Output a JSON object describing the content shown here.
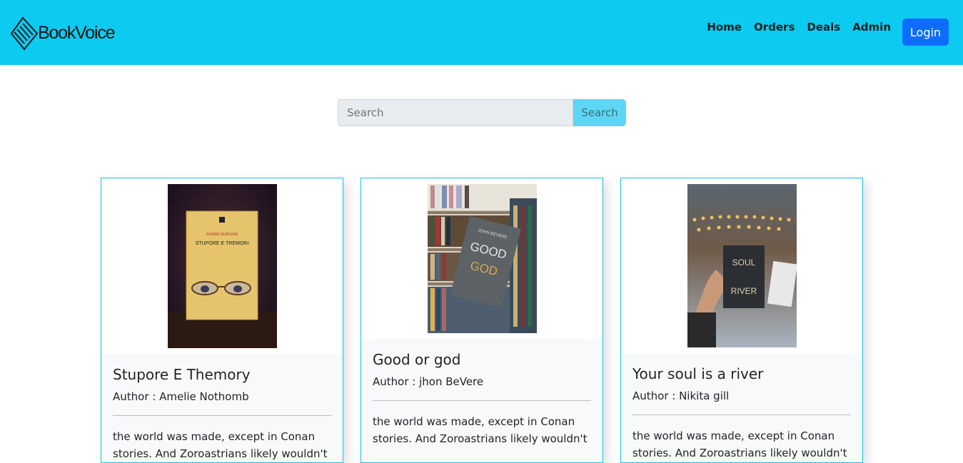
{
  "header": {
    "brand": "BookVoice",
    "nav": [
      "Home",
      "Orders",
      "Deals",
      "Admin"
    ],
    "login_label": "Login"
  },
  "search": {
    "placeholder": "Search",
    "button_label": "Search"
  },
  "books": [
    {
      "title": "Stupore E Themory",
      "author": "Author : Amelie Nothomb",
      "description": "the world was made, except in Conan stories. And Zoroastrians likely wouldn't",
      "cover_label_author": "Amélie Nothomb",
      "cover_label_title": "STUPORE E TREMORI"
    },
    {
      "title": "Good or god",
      "author": "Author : jhon BeVere",
      "description": "the world was made, except in Conan stories. And Zoroastrians likely wouldn't",
      "cover_label_author": "JOHN BEVERE",
      "cover_label_title": "GOOD",
      "cover_label_subtitle": "GOD"
    },
    {
      "title": "Your soul is a river",
      "author": "Author : Nikita gill",
      "description": "the world was made, except in Conan stories. And Zoroastrians likely wouldn't",
      "cover_label_title_1": "SOUL",
      "cover_label_title_2": "RIVER"
    }
  ],
  "colors": {
    "navbar": "#0dcaf0",
    "login": "#0d6efd",
    "search_button": "#5cd6f4",
    "card_border": "#17c2e0"
  }
}
